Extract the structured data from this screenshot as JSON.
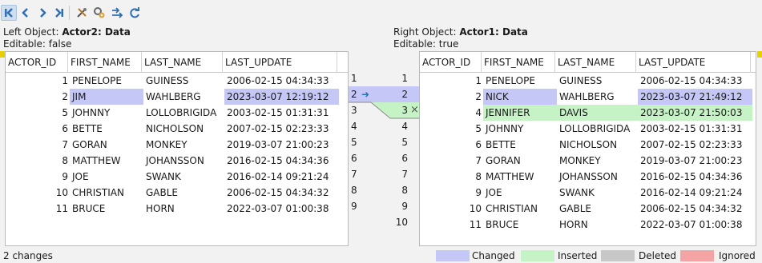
{
  "toolbar": {
    "buttons": [
      {
        "name": "first-diff-icon",
        "glyph": "K"
      },
      {
        "name": "prev-diff-icon",
        "glyph": "<"
      },
      {
        "name": "next-diff-icon",
        "glyph": ">"
      },
      {
        "name": "last-diff-icon",
        "glyph": ">|"
      },
      {
        "name": "tools-icon",
        "glyph": "✕"
      },
      {
        "name": "settings-icon",
        "glyph": "⚙"
      },
      {
        "name": "merge-icon",
        "glyph": "≻"
      },
      {
        "name": "refresh-icon",
        "glyph": "↺"
      }
    ]
  },
  "left": {
    "title_prefix": "Left Object: ",
    "title_name": "Actor2: Data",
    "editable": "Editable: false",
    "columns": [
      "ACTOR_ID",
      "FIRST_NAME",
      "LAST_NAME",
      "LAST_UPDATE"
    ],
    "rows": [
      {
        "id": "1",
        "first": "PENELOPE",
        "last": "GUINESS",
        "update": "2006-02-15 04:34:33",
        "state": ""
      },
      {
        "id": "2",
        "first": "JIM",
        "last": "WAHLBERG",
        "update": "2023-03-07 12:19:12",
        "state": "changed"
      },
      {
        "id": "5",
        "first": "JOHNNY",
        "last": "LOLLOBRIGIDA",
        "update": "2003-02-15 01:31:31",
        "state": ""
      },
      {
        "id": "6",
        "first": "BETTE",
        "last": "NICHOLSON",
        "update": "2007-02-15 02:23:33",
        "state": ""
      },
      {
        "id": "7",
        "first": "GORAN",
        "last": "MONKEY",
        "update": "2019-03-07 21:00:23",
        "state": ""
      },
      {
        "id": "8",
        "first": "MATTHEW",
        "last": "JOHANSSON",
        "update": "2016-02-15 04:34:36",
        "state": ""
      },
      {
        "id": "9",
        "first": "JOE",
        "last": "SWANK",
        "update": "2016-02-14 09:21:24",
        "state": ""
      },
      {
        "id": "10",
        "first": "CHRISTIAN",
        "last": "GABLE",
        "update": "2006-02-15 04:34:32",
        "state": ""
      },
      {
        "id": "11",
        "first": "BRUCE",
        "last": "HORN",
        "update": "2022-03-07 01:00:38",
        "state": ""
      }
    ]
  },
  "right": {
    "title_prefix": "Right Object: ",
    "title_name": "Actor1: Data",
    "editable": "Editable: true",
    "columns": [
      "ACTOR_ID",
      "FIRST_NAME",
      "LAST_NAME",
      "LAST_UPDATE"
    ],
    "rows": [
      {
        "id": "1",
        "first": "PENELOPE",
        "last": "GUINESS",
        "update": "2006-02-15 04:34:33",
        "state": ""
      },
      {
        "id": "2",
        "first": "NICK",
        "last": "WAHLBERG",
        "update": "2023-03-07 21:49:12",
        "state": "changed"
      },
      {
        "id": "4",
        "first": "JENNIFER",
        "last": "DAVIS",
        "update": "2023-03-07 21:50:03",
        "state": "inserted"
      },
      {
        "id": "5",
        "first": "JOHNNY",
        "last": "LOLLOBRIGIDA",
        "update": "2003-02-15 01:31:31",
        "state": ""
      },
      {
        "id": "6",
        "first": "BETTE",
        "last": "NICHOLSON",
        "update": "2007-02-15 02:23:33",
        "state": ""
      },
      {
        "id": "7",
        "first": "GORAN",
        "last": "MONKEY",
        "update": "2019-03-07 21:00:23",
        "state": ""
      },
      {
        "id": "8",
        "first": "MATTHEW",
        "last": "JOHANSSON",
        "update": "2016-02-15 04:34:36",
        "state": ""
      },
      {
        "id": "9",
        "first": "JOE",
        "last": "SWANK",
        "update": "2016-02-14 09:21:24",
        "state": ""
      },
      {
        "id": "10",
        "first": "CHRISTIAN",
        "last": "GABLE",
        "update": "2006-02-15 04:34:32",
        "state": ""
      },
      {
        "id": "11",
        "first": "BRUCE",
        "last": "HORN",
        "update": "2022-03-07 01:00:38",
        "state": ""
      }
    ]
  },
  "gutter": {
    "left_lines": [
      "1",
      "2",
      "3",
      "4",
      "5",
      "6",
      "7",
      "8",
      "9"
    ],
    "right_lines": [
      "1",
      "2",
      "3",
      "4",
      "5",
      "6",
      "7",
      "8",
      "9",
      "10"
    ],
    "merge_arrow": "➜",
    "delete_mark": "×"
  },
  "status": {
    "changes": "2 changes"
  },
  "legend": [
    {
      "label": "Changed",
      "color": "#c5c8f6"
    },
    {
      "label": "Inserted",
      "color": "#c6f3c6"
    },
    {
      "label": "Deleted",
      "color": "#c8c8c8"
    },
    {
      "label": "Ignored",
      "color": "#f4a4a4"
    }
  ]
}
